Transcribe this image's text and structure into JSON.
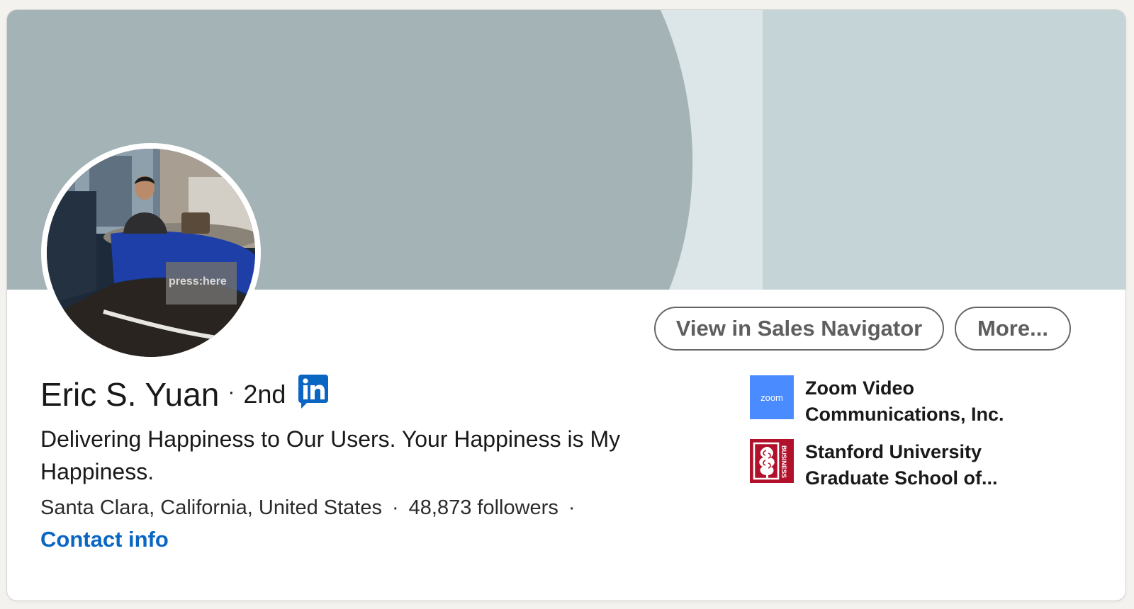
{
  "profile": {
    "name": "Eric S. Yuan",
    "separator": "·",
    "degree": "2nd",
    "headline": "Delivering Happiness to Our Users. Your Happiness is My Happiness.",
    "location": "Santa Clara, California, United States",
    "followers": "48,873 followers",
    "contact_info": "Contact info",
    "avatar_caption": "press:here"
  },
  "actions": {
    "sales_navigator": "View in Sales Navigator",
    "more": "More..."
  },
  "organizations": [
    {
      "logo_text": "zoom",
      "name": "Zoom Video Communications, Inc.",
      "logo_color": "#4a8cff"
    },
    {
      "logo_text": "BUSINESS",
      "name": "Stanford University Graduate School of...",
      "logo_color": "#b1112b"
    }
  ],
  "colors": {
    "link": "#0a66c2",
    "banner_dark": "#a4b3b6",
    "banner_mid": "#dce5e7",
    "banner_light": "#c5d4d7",
    "linkedin_blue": "#0a66c2"
  },
  "icons": {
    "linkedin_badge": "linkedin-icon",
    "stanford_tree": "stanford-tree-icon"
  }
}
